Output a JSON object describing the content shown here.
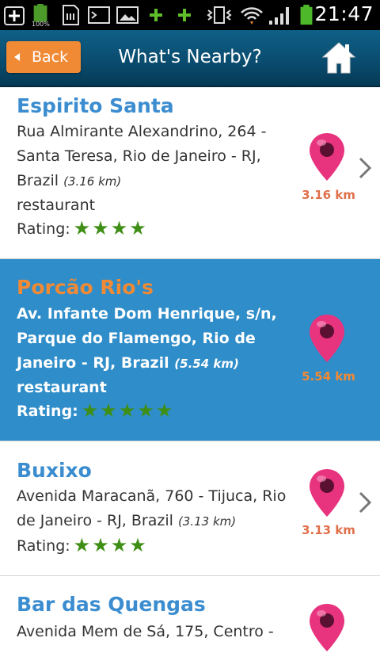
{
  "status_bar": {
    "time": "21:47",
    "battery_label": "100%"
  },
  "header": {
    "back_label": "Back",
    "title": "What's Nearby?"
  },
  "colors": {
    "header": "#0a4d70",
    "accent": "#f08a35",
    "selected_row": "#2f8dc9",
    "name_blue": "#3b8dd0",
    "pin": "#e8337e",
    "star": "#3f8f16"
  },
  "places": [
    {
      "name": "Espirito Santa",
      "address": "Rua Almirante Alexandrino, 264 - Santa Teresa, Rio de Janeiro - RJ, Brazil",
      "distance_inline": "(3.16 km)",
      "type": "restaurant",
      "rating_label": "Rating:",
      "stars": 4,
      "pin_distance": "3.16 km",
      "selected": false
    },
    {
      "name": "Porcão Rio's",
      "address": "Av. Infante Dom Henrique, s/n, Parque do Flamengo, Rio de Janeiro - RJ, Brazil",
      "distance_inline": "(5.54 km)",
      "type": "restaurant",
      "rating_label": "Rating:",
      "stars": 5,
      "pin_distance": "5.54 km",
      "selected": true
    },
    {
      "name": "Buxixo",
      "address": "Avenida Maracanã, 760 - Tijuca, Rio de Janeiro - RJ, Brazil",
      "distance_inline": "(3.13 km)",
      "type": "",
      "rating_label": "Rating:",
      "stars": 4,
      "pin_distance": "3.13 km",
      "selected": false
    },
    {
      "name": "Bar das Quengas",
      "address": "Avenida Mem de Sá, 175, Centro -",
      "distance_inline": "",
      "type": "",
      "rating_label": "",
      "stars": 0,
      "pin_distance": "",
      "selected": false
    }
  ]
}
